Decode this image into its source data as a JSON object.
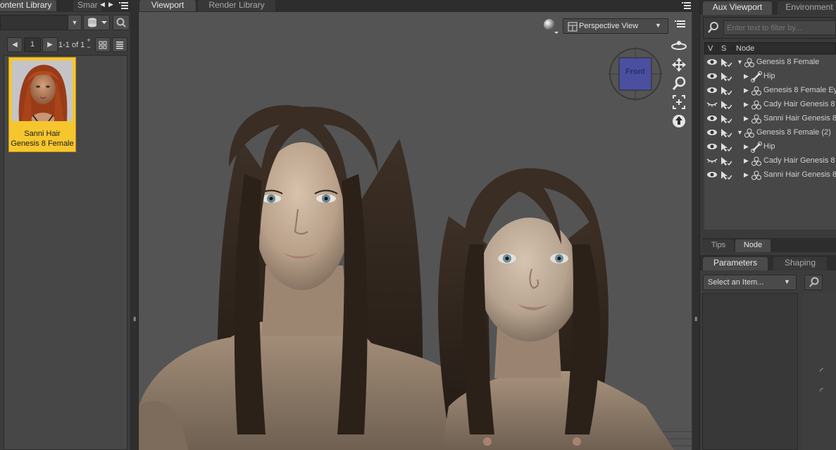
{
  "left_panel": {
    "tabs": {
      "content_library": "ontent Library",
      "smart": "Smar"
    },
    "pagination": {
      "page": "1",
      "range": "1-1 of 1"
    },
    "items": [
      {
        "label_line1": "Sanni Hair",
        "label_line2": "Genesis 8 Female"
      }
    ]
  },
  "viewport": {
    "tabs": {
      "viewport": "Viewport",
      "render_library": "Render Library"
    },
    "view_select": "Perspective View",
    "cube_label": "Front"
  },
  "right_panel": {
    "tabs": {
      "aux_viewport": "Aux Viewport",
      "environment": "Environment"
    },
    "filter_placeholder": "Enter text to filter by...",
    "columns": {
      "v": "V",
      "s": "S",
      "node": "Node"
    },
    "scene_nodes": [
      {
        "label": "Genesis 8 Female",
        "indent": 0,
        "expanded": true,
        "icon": "figure-icon",
        "eye": "open"
      },
      {
        "label": "Hip",
        "indent": 1,
        "expanded": false,
        "icon": "bone-icon",
        "eye": "open"
      },
      {
        "label": "Genesis 8 Female Eye",
        "indent": 1,
        "expanded": false,
        "icon": "figure-icon",
        "eye": "open"
      },
      {
        "label": "Cady Hair Genesis 8 F",
        "indent": 1,
        "expanded": false,
        "icon": "figure-icon",
        "eye": "closed"
      },
      {
        "label": "Sanni Hair Genesis 8 F",
        "indent": 1,
        "expanded": false,
        "icon": "figure-icon",
        "eye": "open"
      },
      {
        "label": "Genesis 8 Female (2)",
        "indent": 0,
        "expanded": true,
        "icon": "figure-icon",
        "eye": "open"
      },
      {
        "label": "Hip",
        "indent": 1,
        "expanded": false,
        "icon": "bone-icon",
        "eye": "open"
      },
      {
        "label": "Cady Hair Genesis 8 F",
        "indent": 1,
        "expanded": false,
        "icon": "figure-icon",
        "eye": "closed"
      },
      {
        "label": "Sanni Hair Genesis 8 F",
        "indent": 1,
        "expanded": false,
        "icon": "figure-icon",
        "eye": "open"
      }
    ],
    "bottom_tabs": {
      "tips": "Tips",
      "node": "Node"
    },
    "param_tabs": {
      "parameters": "Parameters",
      "shaping": "Shaping"
    },
    "item_select": "Select an Item..."
  }
}
